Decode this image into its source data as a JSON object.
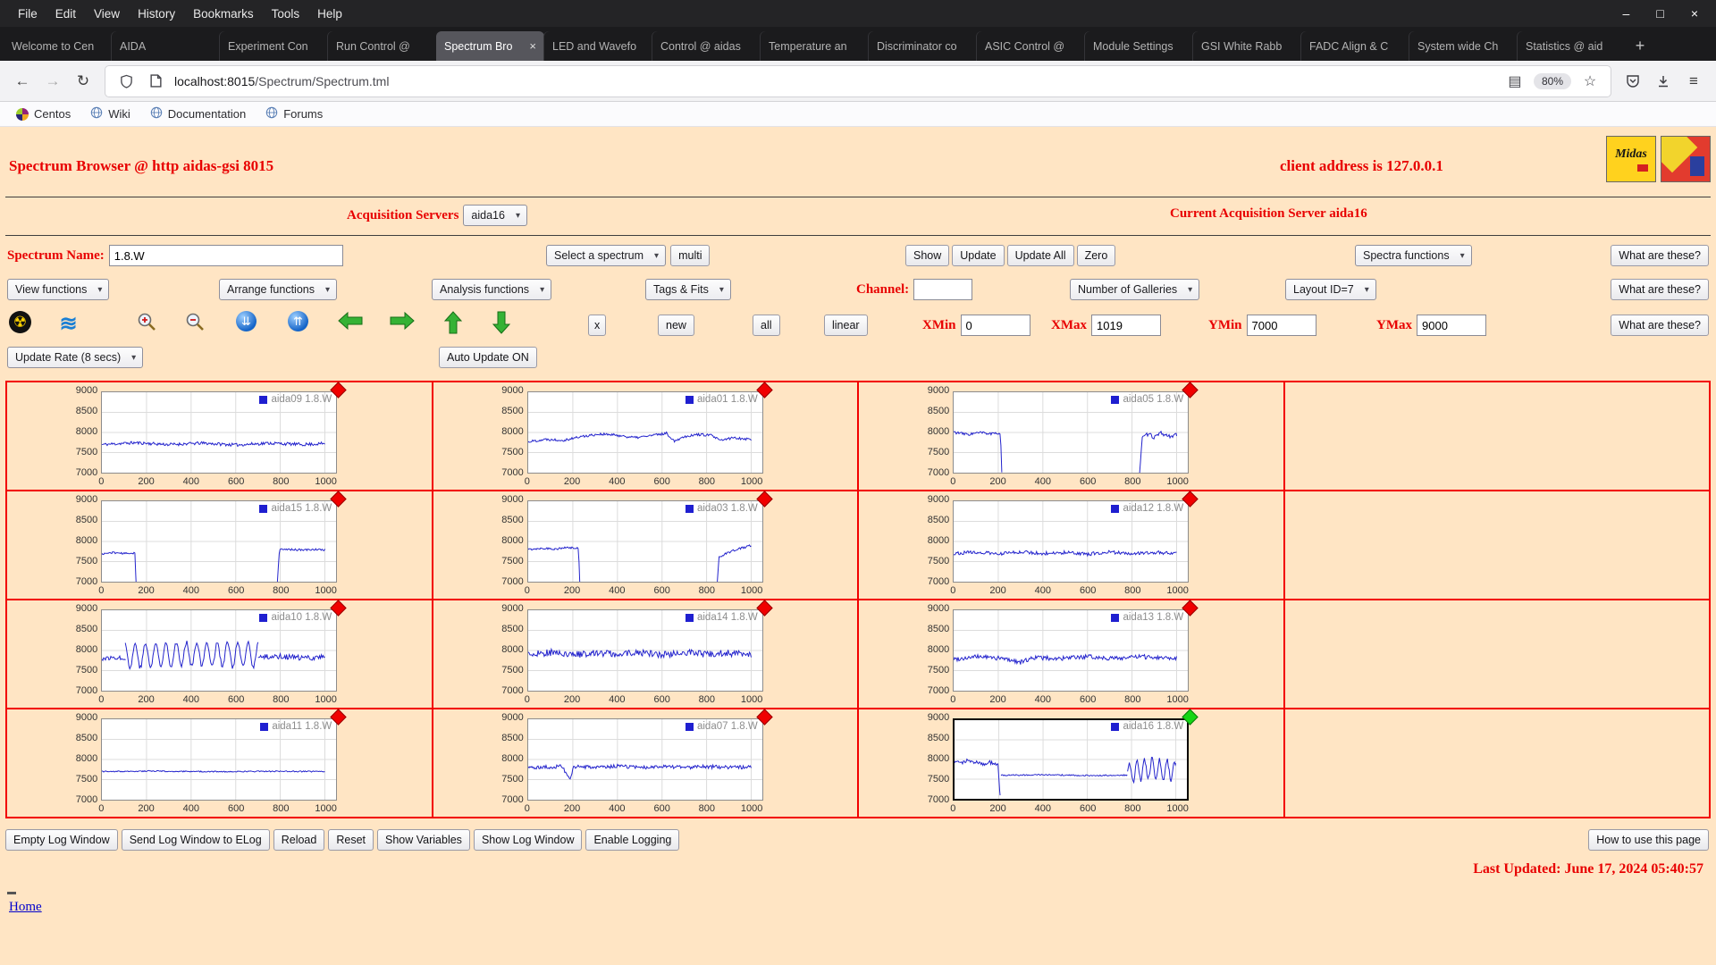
{
  "colors": {
    "background": "#ffe5c4",
    "accent_red": "#e80000",
    "grid_border": "#f20000",
    "trace": "#2222cc",
    "marker_red": "#f00000",
    "marker_green": "#15d615",
    "link": "#0000cc"
  },
  "browser": {
    "menu": {
      "items": [
        "File",
        "Edit",
        "View",
        "History",
        "Bookmarks",
        "Tools",
        "Help"
      ]
    },
    "tabs": [
      {
        "label": "Welcome to Cen"
      },
      {
        "label": "AIDA"
      },
      {
        "label": "Experiment Con"
      },
      {
        "label": "Run Control @"
      },
      {
        "label": "Spectrum Bro",
        "active": true
      },
      {
        "label": "LED and Wavefo"
      },
      {
        "label": "Control @ aidas"
      },
      {
        "label": "Temperature an"
      },
      {
        "label": "Discriminator co"
      },
      {
        "label": "ASIC Control @"
      },
      {
        "label": "Module Settings"
      },
      {
        "label": "GSI White Rabb"
      },
      {
        "label": "FADC Align & C"
      },
      {
        "label": "System wide Ch"
      },
      {
        "label": "Statistics @ aid"
      }
    ],
    "new_tab_label": "+",
    "url_host": "localhost:8015",
    "url_path": "/Spectrum/Spectrum.tml",
    "zoom_badge": "80%",
    "bookmarks": [
      {
        "label": "Centos",
        "icon": "centos-logo-icon"
      },
      {
        "label": "Wiki",
        "icon": "globe-icon"
      },
      {
        "label": "Documentation",
        "icon": "globe-icon"
      },
      {
        "label": "Forums",
        "icon": "globe-icon"
      }
    ]
  },
  "page": {
    "title": "Spectrum Browser @ http aidas-gsi 8015",
    "client_address": "client address is 127.0.0.1",
    "midas_logo_text": "Midas",
    "acquisition_label": "Acquisition Servers",
    "acquisition_server": "aida16",
    "current_server": "Current Acquisition Server aida16",
    "spectrum_name_label": "Spectrum Name:",
    "spectrum_name": "1.8.W",
    "select_spectrum": "Select a spectrum",
    "multi": "multi",
    "show": "Show",
    "update": "Update",
    "update_all": "Update All",
    "zero": "Zero",
    "spectra_functions": "Spectra functions",
    "what_are_these": "What are these?",
    "view_functions": "View functions",
    "arrange_functions": "Arrange functions",
    "analysis_functions": "Analysis functions",
    "tags_fits": "Tags & Fits",
    "channel_label": "Channel:",
    "channel_value": "",
    "number_galleries": "Number of Galleries",
    "layout_id": "Layout ID=7",
    "x_button": "x",
    "new_button": "new",
    "all_button": "all",
    "linear_button": "linear",
    "xmin_label": "XMin",
    "xmin": "0",
    "xmax_label": "XMax",
    "xmax": "1019",
    "ymin_label": "YMin",
    "ymin": "7000",
    "ymax_label": "YMax",
    "ymax": "9000",
    "update_rate": "Update Rate (8 secs)",
    "auto_update": "Auto Update ON",
    "footer_buttons": [
      "Empty Log Window",
      "Send Log Window to ELog",
      "Reload",
      "Reset",
      "Show Variables",
      "Show Log Window",
      "Enable Logging"
    ],
    "how_to": "How to use this page",
    "last_updated": "Last Updated: June 17, 2024 05:40:57",
    "home": "Home"
  },
  "chart_data": {
    "type": "line",
    "xlim": [
      0,
      1050
    ],
    "ylim": [
      7000,
      9000
    ],
    "xticks": [
      0,
      200,
      400,
      600,
      800,
      1000
    ],
    "yticks": [
      9000,
      8500,
      8000,
      7500,
      7000
    ],
    "xlabel": "",
    "ylabel": "",
    "grid": true,
    "legend_position": "top-right",
    "trace_color": "#2222cc",
    "layout": {
      "rows": 4,
      "cols": 4
    },
    "spectra": [
      {
        "name": "aida09 1.8.W",
        "row": 0,
        "col": 0,
        "marker": "red",
        "seed": 11,
        "segments": [
          {
            "noise": 38,
            "points": [
              [
                0,
                7700
              ],
              [
                150,
                7745
              ],
              [
                300,
                7700
              ],
              [
                450,
                7735
              ],
              [
                600,
                7690
              ],
              [
                750,
                7735
              ],
              [
                900,
                7700
              ],
              [
                1000,
                7725
              ]
            ]
          }
        ]
      },
      {
        "name": "aida01 1.8.W",
        "row": 0,
        "col": 1,
        "marker": "red",
        "seed": 22,
        "segments": [
          {
            "noise": 32,
            "points": [
              [
                0,
                7770
              ],
              [
                80,
                7830
              ],
              [
                160,
                7810
              ],
              [
                240,
                7900
              ],
              [
                320,
                7960
              ],
              [
                400,
                7930
              ],
              [
                480,
                7870
              ],
              [
                560,
                7930
              ],
              [
                620,
                7980
              ],
              [
                655,
                7790
              ],
              [
                700,
                7900
              ],
              [
                760,
                7950
              ],
              [
                820,
                7930
              ],
              [
                860,
                7800
              ],
              [
                920,
                7870
              ],
              [
                1000,
                7830
              ]
            ]
          }
        ]
      },
      {
        "name": "aida05 1.8.W",
        "row": 0,
        "col": 2,
        "marker": "red",
        "seed": 33,
        "segments": [
          {
            "noise": 36,
            "points": [
              [
                0,
                8010
              ],
              [
                60,
                7950
              ],
              [
                120,
                7995
              ],
              [
                180,
                7960
              ],
              [
                210,
                7995
              ],
              [
                216,
                7010
              ]
            ]
          },
          {
            "noise": 48,
            "points": [
              [
                834,
                7010
              ],
              [
                846,
                7860
              ],
              [
                872,
                7960
              ],
              [
                900,
                7880
              ],
              [
                932,
                7985
              ],
              [
                962,
                7905
              ],
              [
                1000,
                7935
              ]
            ]
          }
        ]
      },
      {
        "name": "aida15 1.8.W",
        "row": 1,
        "col": 0,
        "marker": "red",
        "seed": 44,
        "segments": [
          {
            "noise": 22,
            "points": [
              [
                0,
                7690
              ],
              [
                50,
                7725
              ],
              [
                100,
                7700
              ],
              [
                148,
                7715
              ],
              [
                153,
                7005
              ]
            ]
          },
          {
            "noise": 26,
            "points": [
              [
                787,
                7005
              ],
              [
                796,
                7795
              ],
              [
                850,
                7805
              ],
              [
                900,
                7785
              ],
              [
                952,
                7805
              ],
              [
                1000,
                7790
              ]
            ]
          }
        ]
      },
      {
        "name": "aida03 1.8.W",
        "row": 1,
        "col": 1,
        "marker": "red",
        "seed": 55,
        "segments": [
          {
            "noise": 26,
            "points": [
              [
                0,
                7800
              ],
              [
                60,
                7835
              ],
              [
                120,
                7815
              ],
              [
                180,
                7845
              ],
              [
                226,
                7825
              ],
              [
                231,
                7005
              ]
            ]
          },
          {
            "noise": 30,
            "points": [
              [
                848,
                7005
              ],
              [
                856,
                7610
              ],
              [
                882,
                7690
              ],
              [
                912,
                7760
              ],
              [
                952,
                7825
              ],
              [
                1000,
                7905
              ]
            ]
          }
        ]
      },
      {
        "name": "aida12 1.8.W",
        "row": 1,
        "col": 2,
        "marker": "red",
        "seed": 66,
        "segments": [
          {
            "noise": 42,
            "points": [
              [
                0,
                7705
              ],
              [
                100,
                7735
              ],
              [
                200,
                7690
              ],
              [
                300,
                7745
              ],
              [
                400,
                7705
              ],
              [
                500,
                7725
              ],
              [
                600,
                7685
              ],
              [
                700,
                7735
              ],
              [
                800,
                7705
              ],
              [
                900,
                7725
              ],
              [
                1000,
                7705
              ]
            ]
          }
        ]
      },
      {
        "name": "aida10 1.8.W",
        "row": 2,
        "col": 0,
        "marker": "red",
        "seed": 77,
        "segments": [
          {
            "noise": 48,
            "points": [
              [
                0,
                7795
              ],
              [
                60,
                7825
              ],
              [
                105,
                7805
              ]
            ]
          },
          {
            "noise": 55,
            "osc": {
              "amp": 300,
              "period": 46
            },
            "points": [
              [
                105,
                7860
              ],
              [
                400,
                7920
              ],
              [
                700,
                7880
              ]
            ]
          },
          {
            "noise": 70,
            "points": [
              [
                700,
                7830
              ],
              [
                800,
                7860
              ],
              [
                900,
                7805
              ],
              [
                1000,
                7845
              ]
            ]
          }
        ]
      },
      {
        "name": "aida14 1.8.W",
        "row": 2,
        "col": 1,
        "marker": "red",
        "seed": 88,
        "segments": [
          {
            "noise": 85,
            "points": [
              [
                0,
                7905
              ],
              [
                100,
                7950
              ],
              [
                200,
                7885
              ],
              [
                300,
                7950
              ],
              [
                400,
                7905
              ],
              [
                500,
                7945
              ],
              [
                600,
                7890
              ],
              [
                700,
                7950
              ],
              [
                800,
                7905
              ],
              [
                900,
                7935
              ],
              [
                1000,
                7905
              ]
            ]
          }
        ]
      },
      {
        "name": "aida13 1.8.W",
        "row": 2,
        "col": 2,
        "marker": "red",
        "seed": 99,
        "segments": [
          {
            "noise": 55,
            "points": [
              [
                0,
                7785
              ],
              [
                120,
                7850
              ],
              [
                240,
                7785
              ],
              [
                300,
                7705
              ],
              [
                360,
                7825
              ],
              [
                480,
                7795
              ],
              [
                600,
                7845
              ],
              [
                720,
                7805
              ],
              [
                840,
                7845
              ],
              [
                1000,
                7815
              ]
            ]
          }
        ]
      },
      {
        "name": "aida11 1.8.W",
        "row": 3,
        "col": 0,
        "marker": "red",
        "seed": 111,
        "segments": [
          {
            "noise": 14,
            "points": [
              [
                0,
                7700
              ],
              [
                250,
                7712
              ],
              [
                500,
                7696
              ],
              [
                750,
                7706
              ],
              [
                1000,
                7700
              ]
            ]
          }
        ]
      },
      {
        "name": "aida07 1.8.W",
        "row": 3,
        "col": 1,
        "marker": "red",
        "seed": 122,
        "segments": [
          {
            "noise": 46,
            "points": [
              [
                0,
                7800
              ],
              [
                150,
                7825
              ],
              [
                188,
                7520
              ],
              [
                205,
                7820
              ],
              [
                300,
                7800
              ],
              [
                400,
                7835
              ],
              [
                500,
                7795
              ],
              [
                600,
                7835
              ],
              [
                700,
                7800
              ],
              [
                800,
                7825
              ],
              [
                900,
                7800
              ],
              [
                1000,
                7815
              ]
            ]
          }
        ]
      },
      {
        "name": "aida16 1.8.W",
        "row": 3,
        "col": 2,
        "marker": "green",
        "selected": true,
        "seed": 133,
        "segments": [
          {
            "noise": 55,
            "points": [
              [
                0,
                7905
              ],
              [
                60,
                7965
              ],
              [
                120,
                7885
              ],
              [
                170,
                7935
              ],
              [
                196,
                7855
              ],
              [
                206,
                7050
              ]
            ]
          },
          {
            "noise": 16,
            "points": [
              [
                210,
                7600
              ],
              [
                400,
                7612
              ],
              [
                600,
                7592
              ],
              [
                780,
                7602
              ]
            ]
          },
          {
            "noise": 65,
            "osc": {
              "amp": 250,
              "period": 34
            },
            "points": [
              [
                782,
                7650
              ],
              [
                900,
                7780
              ],
              [
                1000,
                7720
              ]
            ]
          }
        ]
      }
    ]
  }
}
